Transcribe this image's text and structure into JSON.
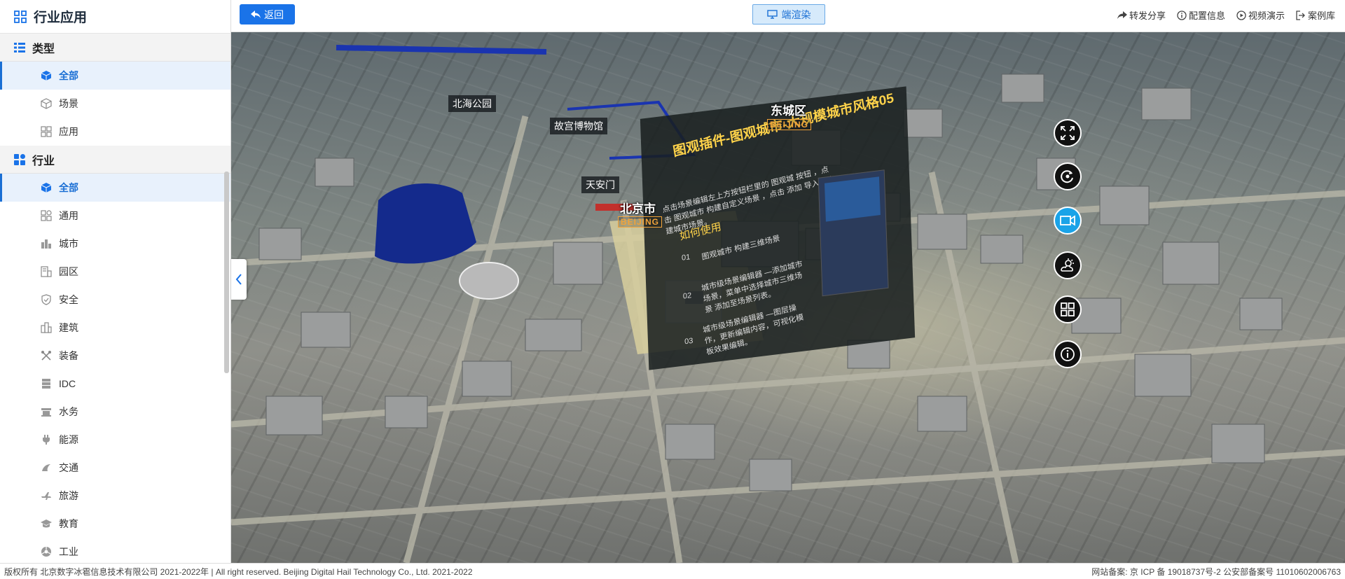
{
  "sidebar": {
    "title": "行业应用",
    "groups": [
      {
        "label": "类型",
        "items": [
          {
            "label": "全部",
            "icon": "cube-icon",
            "active": true
          },
          {
            "label": "场景",
            "icon": "cube-outline-icon"
          },
          {
            "label": "应用",
            "icon": "app-grid-icon"
          }
        ]
      },
      {
        "label": "行业",
        "items": [
          {
            "label": "全部",
            "icon": "cube-icon",
            "active": true
          },
          {
            "label": "通用",
            "icon": "grid-icon"
          },
          {
            "label": "城市",
            "icon": "city-icon"
          },
          {
            "label": "园区",
            "icon": "park-icon"
          },
          {
            "label": "安全",
            "icon": "shield-icon"
          },
          {
            "label": "建筑",
            "icon": "building-icon"
          },
          {
            "label": "装备",
            "icon": "tools-icon"
          },
          {
            "label": "IDC",
            "icon": "server-icon"
          },
          {
            "label": "水务",
            "icon": "water-icon"
          },
          {
            "label": "能源",
            "icon": "plug-icon"
          },
          {
            "label": "交通",
            "icon": "traffic-icon"
          },
          {
            "label": "旅游",
            "icon": "travel-icon"
          },
          {
            "label": "教育",
            "icon": "education-icon"
          },
          {
            "label": "工业",
            "icon": "industry-icon"
          }
        ]
      }
    ]
  },
  "topbar": {
    "back_label": "返回",
    "render_label": "端渲染",
    "links": [
      {
        "label": "转发分享",
        "icon": "share-icon"
      },
      {
        "label": "配置信息",
        "icon": "info-icon"
      },
      {
        "label": "视频演示",
        "icon": "play-icon"
      },
      {
        "label": "案例库",
        "icon": "exit-icon"
      }
    ]
  },
  "map": {
    "labels": {
      "beihai": "北海公园",
      "gugong": "故宫博物馆",
      "tiananmen": "天安门",
      "dongcheng": "东城区",
      "beijing_city": "北京市",
      "beijing_tag": "BEIJING",
      "beijing_tag2": "BEIJING"
    },
    "panel": {
      "title": "图观插件-图观城市-大规模城市风格05",
      "line1": "点击场景编辑左上方按钮栏里的  图观城 按钮 ，点击  图观城市  构建自定义场景 ，点击  添加  导入已构建城市场景。",
      "how": "如何使用",
      "step1_no": "01",
      "step1": "图观城市  构建三维场景",
      "step2_no": "02",
      "step2": "城市级场景编辑器 —添加城市场景，菜单中选择城市三维场景 添加至场景列表。",
      "step3_no": "03",
      "step3": "城市级场景编辑器 —图层操作，更新编辑内容，可视化模板效果编辑。"
    }
  },
  "tools": [
    "fullscreen-icon",
    "rotate-icon",
    "video-icon",
    "weather-icon",
    "layout-icon",
    "info-icon"
  ],
  "footer": {
    "left": "版权所有 北京数字冰雹信息技术有限公司 2021-2022年 | All right reserved. Beijing Digital Hail Technology Co., Ltd. 2021-2022",
    "right": "网站备案: 京 ICP 备 19018737号-2 公安部备案号 11010602006763"
  },
  "colors": {
    "accent": "#1a73e8",
    "active_bg": "#e8f1fc",
    "tool_active": "#1aa3e8",
    "panel_title": "#ffd34a"
  }
}
